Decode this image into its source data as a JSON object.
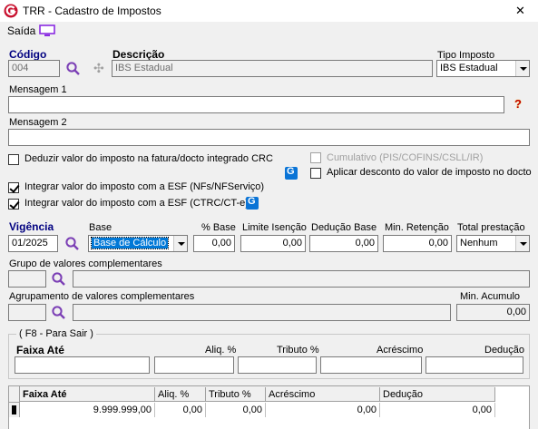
{
  "window": {
    "title": "TRR - Cadastro de Impostos",
    "close_glyph": "✕"
  },
  "menu": {
    "saida_label": "Saída"
  },
  "codigo": {
    "label": "Código",
    "value": "004"
  },
  "descricao": {
    "label": "Descrição",
    "value": "IBS Estadual"
  },
  "tipo_imposto": {
    "label": "Tipo Imposto",
    "value": "IBS Estadual"
  },
  "mensagem1": {
    "label": "Mensagem 1",
    "value": ""
  },
  "mensagem2": {
    "label": "Mensagem 2",
    "value": ""
  },
  "help_glyph": "?",
  "checkboxes": {
    "deduzir": {
      "label": "Deduzir valor do imposto na fatura/docto integrado CRC",
      "checked": false
    },
    "cumulativo": {
      "label": "Cumulativo (PIS/COFINS/CSLL/IR)",
      "checked": false,
      "disabled": true
    },
    "aplicar_desconto": {
      "label": "Aplicar desconto do valor de imposto no docto",
      "checked": false
    },
    "integrar_nfs": {
      "label": "Integrar valor do imposto com a ESF (NFs/NFServiço)",
      "checked": true
    },
    "integrar_ctrc": {
      "label": "Integrar valor do imposto com a ESF (CTRC/CT-e)",
      "checked": true
    }
  },
  "vigencia": {
    "label": "Vigência",
    "value": "01/2025"
  },
  "base": {
    "label": "Base",
    "value": "Base de Cálculo"
  },
  "pct_base": {
    "label": "% Base",
    "value": "0,00"
  },
  "limite_isencao": {
    "label": "Limite Isenção",
    "value": "0,00"
  },
  "deducao_base": {
    "label": "Dedução Base",
    "value": "0,00"
  },
  "min_retencao": {
    "label": "Min. Retenção",
    "value": "0,00"
  },
  "total_prestacao": {
    "label": "Total prestação",
    "value": "Nenhum"
  },
  "grupo_valores": {
    "label": "Grupo de valores complementares",
    "code": "",
    "value": ""
  },
  "agrupamento_valores": {
    "label": "Agrupamento de valores complementares",
    "code": "",
    "value": ""
  },
  "min_acumulo": {
    "label": "Min. Acumulo",
    "value": "0,00"
  },
  "faixas_group": {
    "caption": "( F8 - Para Sair )",
    "faixa_ate": "Faixa Até",
    "aliq": "Aliq. %",
    "tributo": "Tributo %",
    "acrescimo": "Acréscimo",
    "deducao": "Dedução"
  },
  "grid": {
    "columns": [
      "Faixa Até",
      "Aliq. %",
      "Tributo %",
      "Acréscimo",
      "Dedução"
    ],
    "rows": [
      {
        "faixa_ate": "9.999.999,00",
        "aliq": "0,00",
        "tributo": "0,00",
        "acrescimo": "0,00",
        "deducao": "0,00"
      }
    ]
  },
  "colors": {
    "window_bg": "#f0f0f0",
    "accent_navy": "#000080",
    "selection_blue": "#0078d7",
    "logo_red": "#c8102e",
    "lens_purple": "#7b3fb5"
  }
}
